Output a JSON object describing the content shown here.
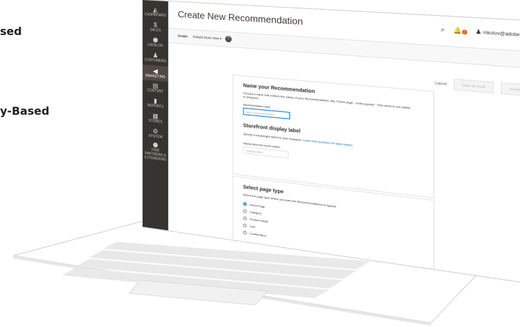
{
  "side_texts": {
    "line1": "sed",
    "line2": "y-Based"
  },
  "admin_nav": [
    {
      "label": "DASHBOARD",
      "icon": "dashboard-icon",
      "glyph": "◭"
    },
    {
      "label": "SALES",
      "icon": "dollar-icon",
      "glyph": "$"
    },
    {
      "label": "CATALOG",
      "icon": "cube-icon",
      "glyph": "⬢"
    },
    {
      "label": "CUSTOMERS",
      "icon": "person-icon",
      "glyph": "♟"
    },
    {
      "label": "MARKETING",
      "icon": "megaphone-icon",
      "glyph": "📢"
    },
    {
      "label": "CONTENT",
      "icon": "content-icon",
      "glyph": "▤"
    },
    {
      "label": "REPORTS",
      "icon": "bar-chart-icon",
      "glyph": "▮"
    },
    {
      "label": "STORES",
      "icon": "store-icon",
      "glyph": "▦"
    },
    {
      "label": "SYSTEM",
      "icon": "gear-icon",
      "glyph": "⚙"
    },
    {
      "label": "FIND PARTNERS & EXTENSIONS",
      "icon": "extensions-icon",
      "glyph": "⬣"
    }
  ],
  "header": {
    "title": "Create New Recommendation",
    "notification_count": "2",
    "user": "mkotov@adobe.c..."
  },
  "scope": {
    "label": "Scope:",
    "value": "Default Store View ▾"
  },
  "actions": {
    "cancel": "Cancel",
    "save_draft": "Save as Draft",
    "activate": "Activate"
  },
  "name_section": {
    "heading": "Name your Recommendation",
    "description": "Choose a name that reflects the nature of your Recommendation, like “Home page - most popular.” This name is not visible to shoppers.",
    "field_label": "Recommendation name",
    "field_placeholder": "Best recommendation"
  },
  "label_section": {
    "heading": "Storefront display label",
    "description": "Specify a meaningful label for your shoppers.",
    "link": "Learn best practices for label names.",
    "field_label": "Display label seen by the visitors",
    "field_placeholder": "Display label"
  },
  "page_type_section": {
    "heading": "Select page type",
    "description": "Select the page type where you want the Recommendations to appear.",
    "options": [
      "Home Page",
      "Category",
      "Product Detail",
      "Cart",
      "Confirmation"
    ],
    "selected": "Home Page"
  },
  "colors": {
    "accent": "#007bdb",
    "admin_bar": "#373330",
    "badge": "#eb5202"
  }
}
